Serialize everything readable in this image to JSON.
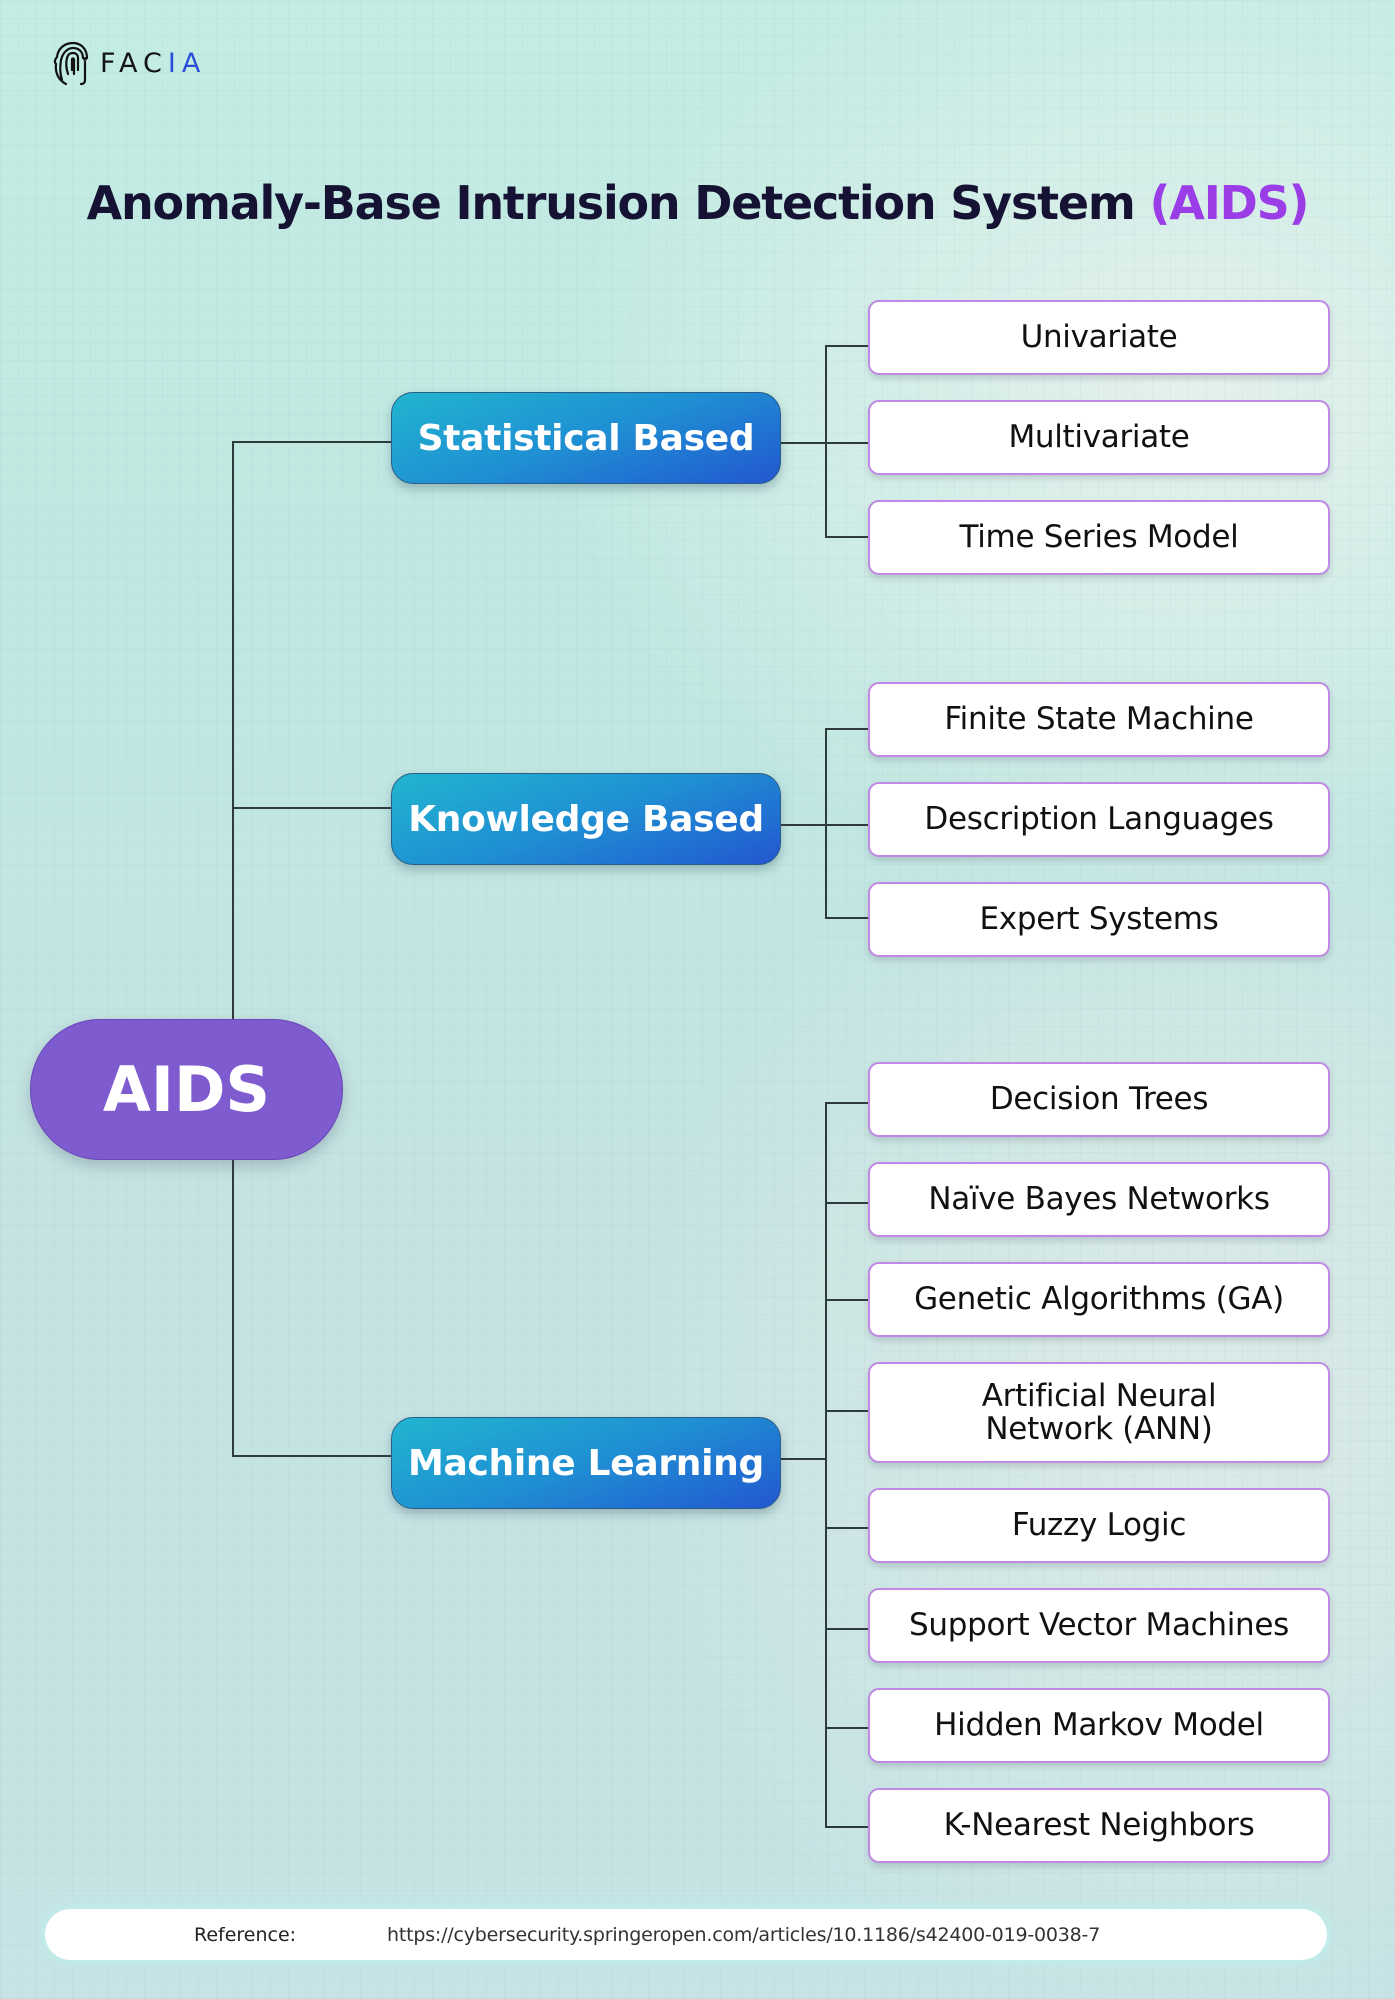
{
  "logo": {
    "text_main": "FAC",
    "text_accent": "IA",
    "icon": "fingerprint-head-icon",
    "accent_color": "#2b4fd8"
  },
  "title": {
    "main": "Anomaly-Base Intrusion Detection System",
    "accent": "(AIDS)",
    "accent_color": "#9a3de6"
  },
  "root": {
    "label": "AIDS",
    "color": "#7f5bd0"
  },
  "branches": [
    {
      "label": "Statistical Based",
      "leaves": [
        "Univariate",
        "Multivariate",
        "Time Series Model"
      ]
    },
    {
      "label": "Knowledge Based",
      "leaves": [
        "Finite State Machine",
        "Description Languages",
        "Expert Systems"
      ]
    },
    {
      "label": "Machine Learning",
      "leaves": [
        "Decision Trees",
        "Naïve Bayes Networks",
        "Genetic Algorithms (GA)",
        "Artificial Neural Network (ANN)",
        "Fuzzy Logic",
        "Support Vector Machines",
        "Hidden Markov Model",
        "K-Nearest Neighbors"
      ]
    }
  ],
  "reference": {
    "label": "Reference:",
    "url": "https://cybersecurity.springeropen.com/articles/10.1186/s42400-019-0038-7"
  }
}
